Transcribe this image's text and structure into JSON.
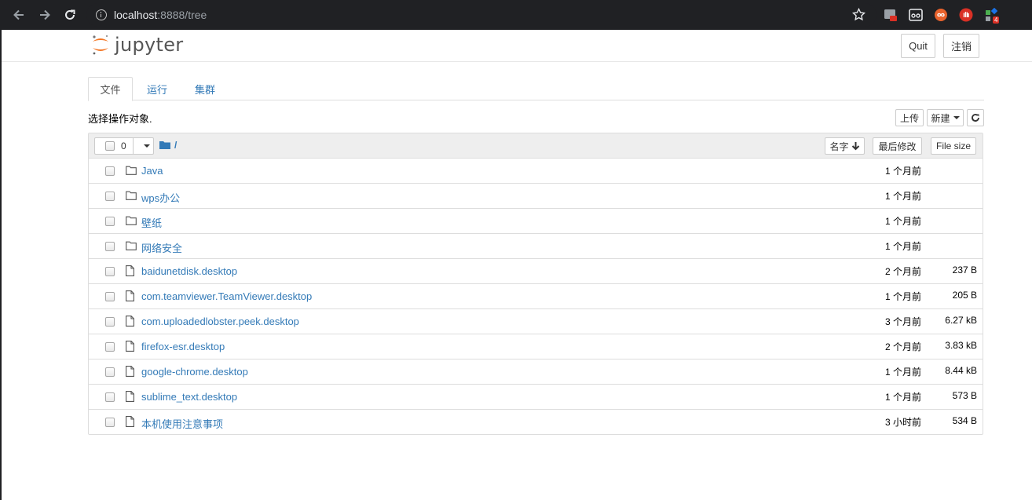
{
  "browser": {
    "url_host": "localhost",
    "url_path": ":8888/tree",
    "ext_badge_2": "4"
  },
  "header": {
    "logo_text": "jupyter",
    "quit_label": "Quit",
    "logout_label": "注销"
  },
  "tabs": [
    {
      "label": "文件"
    },
    {
      "label": "运行"
    },
    {
      "label": "集群"
    }
  ],
  "toolbar": {
    "hint": "选择操作对象.",
    "upload_label": "上传",
    "new_label": "新建"
  },
  "list_header": {
    "selected_count": "0",
    "breadcrumb": "/",
    "sort_name_label": "名字",
    "sort_modified_label": "最后修改",
    "sort_size_label": "File size"
  },
  "items": [
    {
      "name": "Java",
      "type": "folder",
      "modified": "1 个月前",
      "size": ""
    },
    {
      "name": "wps办公",
      "type": "folder",
      "modified": "1 个月前",
      "size": ""
    },
    {
      "name": "壁纸",
      "type": "folder",
      "modified": "1 个月前",
      "size": ""
    },
    {
      "name": "网络安全",
      "type": "folder",
      "modified": "1 个月前",
      "size": ""
    },
    {
      "name": "baidunetdisk.desktop",
      "type": "file",
      "modified": "2 个月前",
      "size": "237 B"
    },
    {
      "name": "com.teamviewer.TeamViewer.desktop",
      "type": "file",
      "modified": "1 个月前",
      "size": "205 B"
    },
    {
      "name": "com.uploadedlobster.peek.desktop",
      "type": "file",
      "modified": "3 个月前",
      "size": "6.27 kB"
    },
    {
      "name": "firefox-esr.desktop",
      "type": "file",
      "modified": "2 个月前",
      "size": "3.83 kB"
    },
    {
      "name": "google-chrome.desktop",
      "type": "file",
      "modified": "1 个月前",
      "size": "8.44 kB"
    },
    {
      "name": "sublime_text.desktop",
      "type": "file",
      "modified": "1 个月前",
      "size": "573 B"
    },
    {
      "name": "本机使用注意事项",
      "type": "file",
      "modified": "3 小时前",
      "size": "534 B"
    }
  ],
  "colors": {
    "link": "#337ab7",
    "chrome_bg": "#202124",
    "jupyter_orange": "#f37726"
  }
}
